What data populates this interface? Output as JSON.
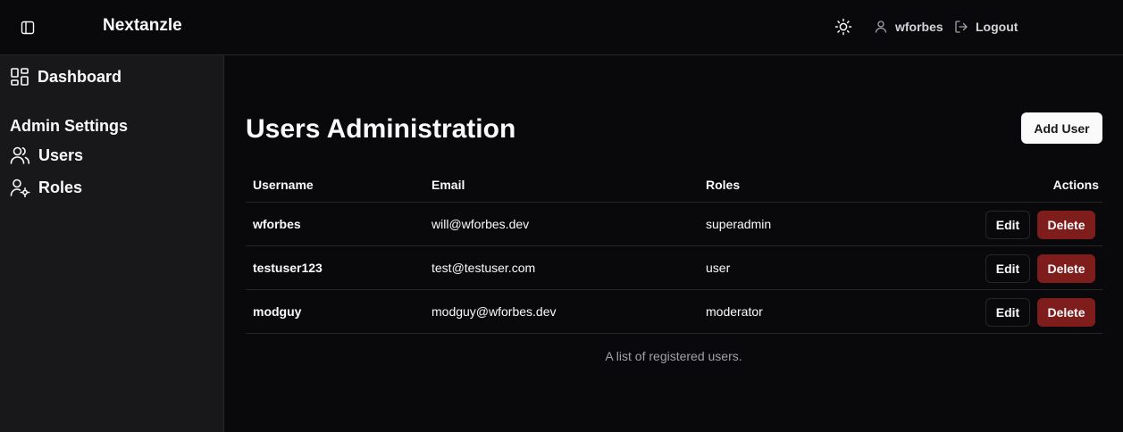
{
  "header": {
    "brand": "Nextanzle",
    "username": "wforbes",
    "logout_label": "Logout"
  },
  "sidebar": {
    "dashboard_label": "Dashboard",
    "section_heading": "Admin Settings",
    "items": [
      {
        "label": "Users",
        "icon": "users-icon"
      },
      {
        "label": "Roles",
        "icon": "user-cog-icon"
      }
    ]
  },
  "main": {
    "title": "Users Administration",
    "add_user_label": "Add User",
    "table": {
      "headers": {
        "username": "Username",
        "email": "Email",
        "roles": "Roles",
        "actions": "Actions"
      },
      "rows": [
        {
          "username": "wforbes",
          "email": "will@wforbes.dev",
          "roles": "superadmin"
        },
        {
          "username": "testuser123",
          "email": "test@testuser.com",
          "roles": "user"
        },
        {
          "username": "modguy",
          "email": "modguy@wforbes.dev",
          "roles": "moderator"
        }
      ],
      "edit_label": "Edit",
      "delete_label": "Delete",
      "caption": "A list of registered users."
    }
  },
  "colors": {
    "background": "#09090b",
    "sidebar": "#18181b",
    "border": "#27272a",
    "delete": "#7f1d1d",
    "muted_text": "#a1a1aa"
  }
}
